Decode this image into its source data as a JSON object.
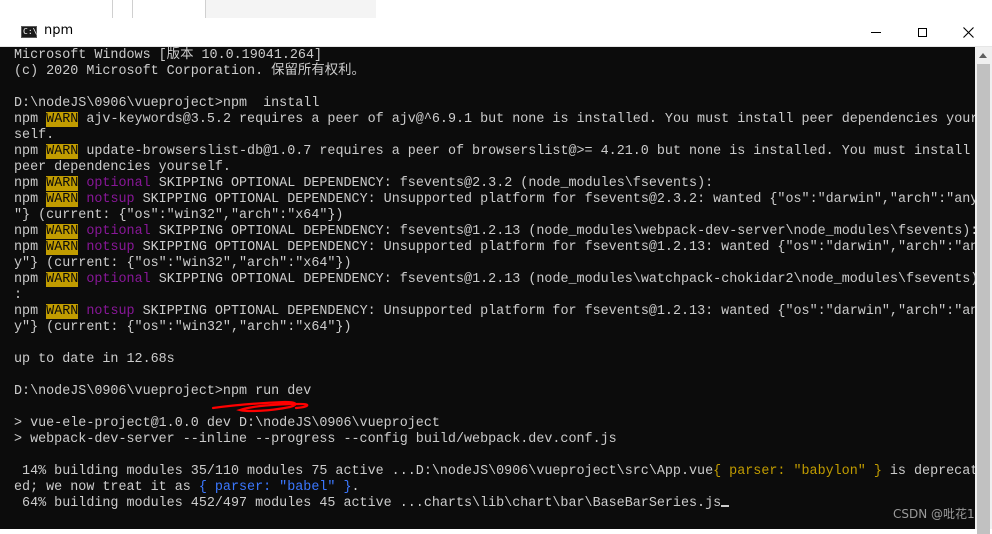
{
  "window": {
    "title": "npm",
    "icon_text": "C:\\_",
    "buttons": {
      "minimize": "minimize-icon",
      "maximize": "maximize-icon",
      "close": "✕"
    }
  },
  "console": {
    "lines": [
      [
        {
          "t": "Microsoft Windows [版本 10.0.19041.264]"
        }
      ],
      [
        {
          "t": "(c) 2020 Microsoft Corporation. 保留所有权利。"
        }
      ],
      [
        {
          "t": ""
        }
      ],
      [
        {
          "t": "D:\\nodeJS\\0906\\vueproject>npm  install"
        }
      ],
      [
        {
          "t": "npm "
        },
        {
          "t": "WARN",
          "c": "warn"
        },
        {
          "t": " ajv-keywords@3.5.2 requires a peer of ajv@^6.9.1 but none is installed. You must install peer dependencies yours"
        }
      ],
      [
        {
          "t": "self."
        }
      ],
      [
        {
          "t": "npm "
        },
        {
          "t": "WARN",
          "c": "warn"
        },
        {
          "t": " update-browserslist-db@1.0.7 requires a peer of browserslist@>= 4.21.0 but none is installed. You must install"
        }
      ],
      [
        {
          "t": "peer dependencies yourself."
        }
      ],
      [
        {
          "t": "npm "
        },
        {
          "t": "WARN",
          "c": "warn"
        },
        {
          "t": " "
        },
        {
          "t": "optional",
          "c": "optional"
        },
        {
          "t": " SKIPPING OPTIONAL DEPENDENCY: fsevents@2.3.2 (node_modules\\fsevents):"
        }
      ],
      [
        {
          "t": "npm "
        },
        {
          "t": "WARN",
          "c": "warn"
        },
        {
          "t": " "
        },
        {
          "t": "notsup",
          "c": "notsup"
        },
        {
          "t": " SKIPPING OPTIONAL DEPENDENCY: Unsupported platform for fsevents@2.3.2: wanted {\"os\":\"darwin\",\"arch\":\"any"
        }
      ],
      [
        {
          "t": "\"} (current: {\"os\":\"win32\",\"arch\":\"x64\"})"
        }
      ],
      [
        {
          "t": "npm "
        },
        {
          "t": "WARN",
          "c": "warn"
        },
        {
          "t": " "
        },
        {
          "t": "optional",
          "c": "optional"
        },
        {
          "t": " SKIPPING OPTIONAL DEPENDENCY: fsevents@1.2.13 (node_modules\\webpack-dev-server\\node_modules\\fsevents):"
        }
      ],
      [
        {
          "t": "npm "
        },
        {
          "t": "WARN",
          "c": "warn"
        },
        {
          "t": " "
        },
        {
          "t": "notsup",
          "c": "notsup"
        },
        {
          "t": " SKIPPING OPTIONAL DEPENDENCY: Unsupported platform for fsevents@1.2.13: wanted {\"os\":\"darwin\",\"arch\":\"an"
        }
      ],
      [
        {
          "t": "y\"} (current: {\"os\":\"win32\",\"arch\":\"x64\"})"
        }
      ],
      [
        {
          "t": "npm "
        },
        {
          "t": "WARN",
          "c": "warn"
        },
        {
          "t": " "
        },
        {
          "t": "optional",
          "c": "optional"
        },
        {
          "t": " SKIPPING OPTIONAL DEPENDENCY: fsevents@1.2.13 (node_modules\\watchpack-chokidar2\\node_modules\\fsevents)"
        }
      ],
      [
        {
          "t": ":"
        }
      ],
      [
        {
          "t": "npm "
        },
        {
          "t": "WARN",
          "c": "warn"
        },
        {
          "t": " "
        },
        {
          "t": "notsup",
          "c": "notsup"
        },
        {
          "t": " SKIPPING OPTIONAL DEPENDENCY: Unsupported platform for fsevents@1.2.13: wanted {\"os\":\"darwin\",\"arch\":\"an"
        }
      ],
      [
        {
          "t": "y\"} (current: {\"os\":\"win32\",\"arch\":\"x64\"})"
        }
      ],
      [
        {
          "t": ""
        }
      ],
      [
        {
          "t": "up to date in 12.68s"
        }
      ],
      [
        {
          "t": ""
        }
      ],
      [
        {
          "t": "D:\\nodeJS\\0906\\vueproject>npm run dev"
        }
      ],
      [
        {
          "t": ""
        }
      ],
      [
        {
          "t": "> vue-ele-project@1.0.0 dev D:\\nodeJS\\0906\\vueproject"
        }
      ],
      [
        {
          "t": "> webpack-dev-server --inline --progress --config build/webpack.dev.conf.js"
        }
      ],
      [
        {
          "t": ""
        }
      ],
      [
        {
          "t": " 14% building modules 35/110 modules 75 active ...D:\\nodeJS\\0906\\vueproject\\src\\App.vue"
        },
        {
          "t": "{ parser: \"babylon\" }",
          "c": "yellow"
        },
        {
          "t": " is deprecat"
        }
      ],
      [
        {
          "t": "ed; we now treat it as "
        },
        {
          "t": "{ parser: \"babel\" }",
          "c": "blue"
        },
        {
          "t": "."
        }
      ],
      [
        {
          "t": " 64% building modules 452/497 modules 45 active ...charts\\lib\\chart\\bar\\BaseBarSeries.js"
        },
        {
          "t": "",
          "c": "cursor"
        }
      ]
    ]
  },
  "colors": {
    "console_bg": "#0c0c0c",
    "console_fg": "#cccccc",
    "warn_bg": "#c19c00",
    "magenta": "#881798",
    "blue": "#3b78ff",
    "annotation": "#ff0000"
  },
  "watermark": "CSDN @吡花1"
}
